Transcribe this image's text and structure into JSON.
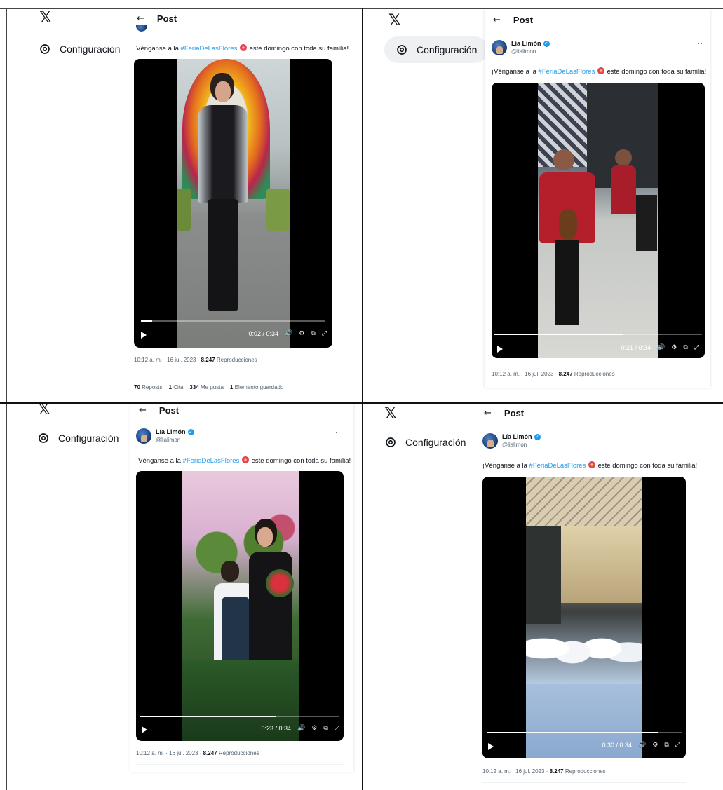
{
  "panels": [
    {
      "logo": "𝕏",
      "settings": {
        "icon": "gear-icon",
        "label": "Configuración"
      },
      "header": {
        "back_icon": "←",
        "title": "Post"
      },
      "author": null,
      "tweet": {
        "prefix": "¡Vénganse a la ",
        "hashtag": "#FeriaDeLasFlores",
        "suffix": " este domingo con toda su familia!"
      },
      "video": {
        "time": "0:02 / 0:34",
        "progress": 0.06
      },
      "meta": {
        "time_date": "10:12 a. m. · 16 jul. 2023 · ",
        "views": "8.247",
        "views_label": " Reproducciones"
      },
      "stats": [
        {
          "value": "70",
          "label": "Reposts"
        },
        {
          "value": "1",
          "label": "Cita"
        },
        {
          "value": "334",
          "label": "Me gusta"
        },
        {
          "value": "1",
          "label": "Elemento guardado"
        }
      ]
    },
    {
      "logo": "𝕏",
      "settings": {
        "icon": "gear-icon",
        "label": "Configuración"
      },
      "header": {
        "back_icon": "←",
        "title": "Post"
      },
      "author": {
        "name": "Lía Limón",
        "handle": "@lialimon",
        "more": "···"
      },
      "tweet": {
        "prefix": "¡Vénganse a la ",
        "hashtag": "#FeriaDeLasFlores",
        "suffix": " este domingo con toda su familia!"
      },
      "video": {
        "time": "0:21 / 0:34",
        "progress": 0.62
      },
      "meta": {
        "time_date": "10:12 a. m. · 16 jul. 2023 · ",
        "views": "8.247",
        "views_label": " Reproducciones"
      }
    },
    {
      "logo": "𝕏",
      "settings": {
        "icon": "gear-icon",
        "label": "Configuración"
      },
      "header": {
        "back_icon": "←",
        "title": "Post"
      },
      "author": {
        "name": "Lía Limón",
        "handle": "@lialimon",
        "more": "···"
      },
      "tweet": {
        "prefix": "¡Vénganse a la ",
        "hashtag": "#FeriaDeLasFlores",
        "suffix": " este domingo con toda su familia!"
      },
      "video": {
        "time": "0:23 / 0:34",
        "progress": 0.68
      },
      "meta": {
        "time_date": "10:12 a. m. · 16 jul. 2023 · ",
        "views": "8.247",
        "views_label": " Reproducciones"
      }
    },
    {
      "logo": "𝕏",
      "settings": {
        "icon": "gear-icon",
        "label": "Configuración"
      },
      "header": {
        "back_icon": "←",
        "title": "Post"
      },
      "author": {
        "name": "Lía Limón",
        "handle": "@lialimon",
        "more": "···"
      },
      "tweet": {
        "prefix": "¡Vénganse a la ",
        "hashtag": "#FeriaDeLasFlores",
        "suffix": " este domingo con toda su familia!"
      },
      "video": {
        "time": "0:30 / 0:34",
        "progress": 0.88
      },
      "meta": {
        "time_date": "10:12 a. m. · 16 jul. 2023 · ",
        "views": "8.247",
        "views_label": " Reproducciones"
      }
    }
  ],
  "video_controls": {
    "volume_icon": "🔊",
    "settings_icon": "⚙",
    "pip_icon": "⧉",
    "fullscreen_icon": "⤢"
  },
  "colors": {
    "accent": "#1d9bf0",
    "text": "#0f1419",
    "muted": "#536471"
  }
}
